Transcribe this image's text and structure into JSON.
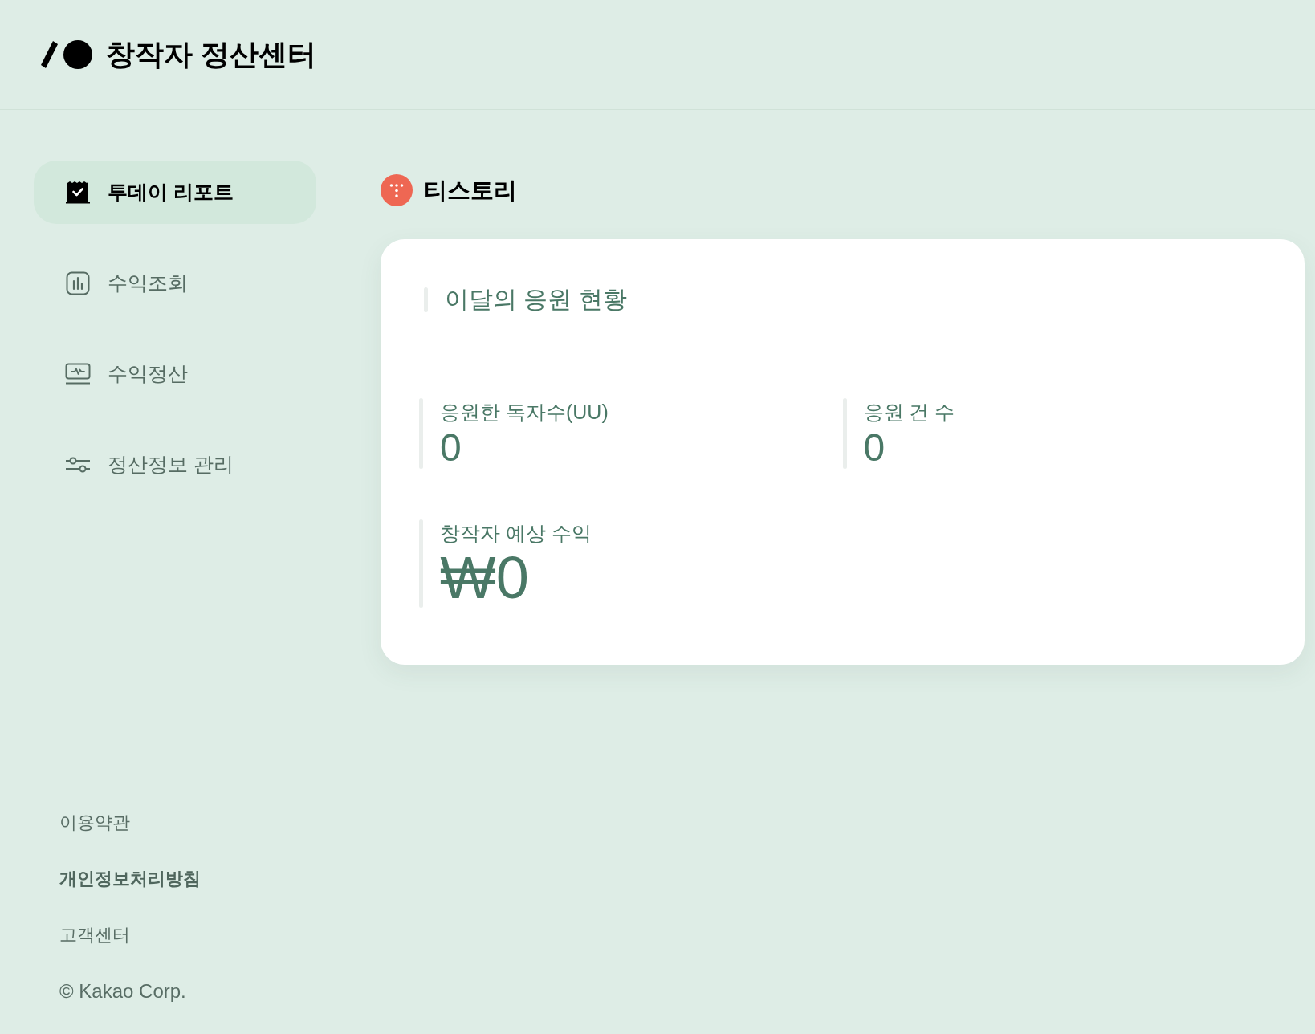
{
  "header": {
    "title": "창작자 정산센터"
  },
  "sidebar": {
    "items": [
      {
        "label": "투데이 리포트",
        "selected": true
      },
      {
        "label": "수익조회",
        "selected": false
      },
      {
        "label": "수익정산",
        "selected": false
      },
      {
        "label": "정산정보 관리",
        "selected": false
      }
    ],
    "footer_links": [
      {
        "label": "이용약관",
        "emphasized": false
      },
      {
        "label": "개인정보처리방침",
        "emphasized": true
      },
      {
        "label": "고객센터",
        "emphasized": false
      }
    ],
    "copyright": "© Kakao Corp."
  },
  "main": {
    "service": {
      "name": "티스토리"
    },
    "card": {
      "title": "이달의 응원 현황",
      "stats": [
        {
          "kind": "count",
          "label": "응원한 독자수(UU)",
          "value": "0"
        },
        {
          "kind": "count",
          "label": "응원 건 수",
          "value": "0"
        },
        {
          "kind": "amount",
          "label": "창작자 예상 수익",
          "value": "₩0"
        }
      ]
    }
  }
}
